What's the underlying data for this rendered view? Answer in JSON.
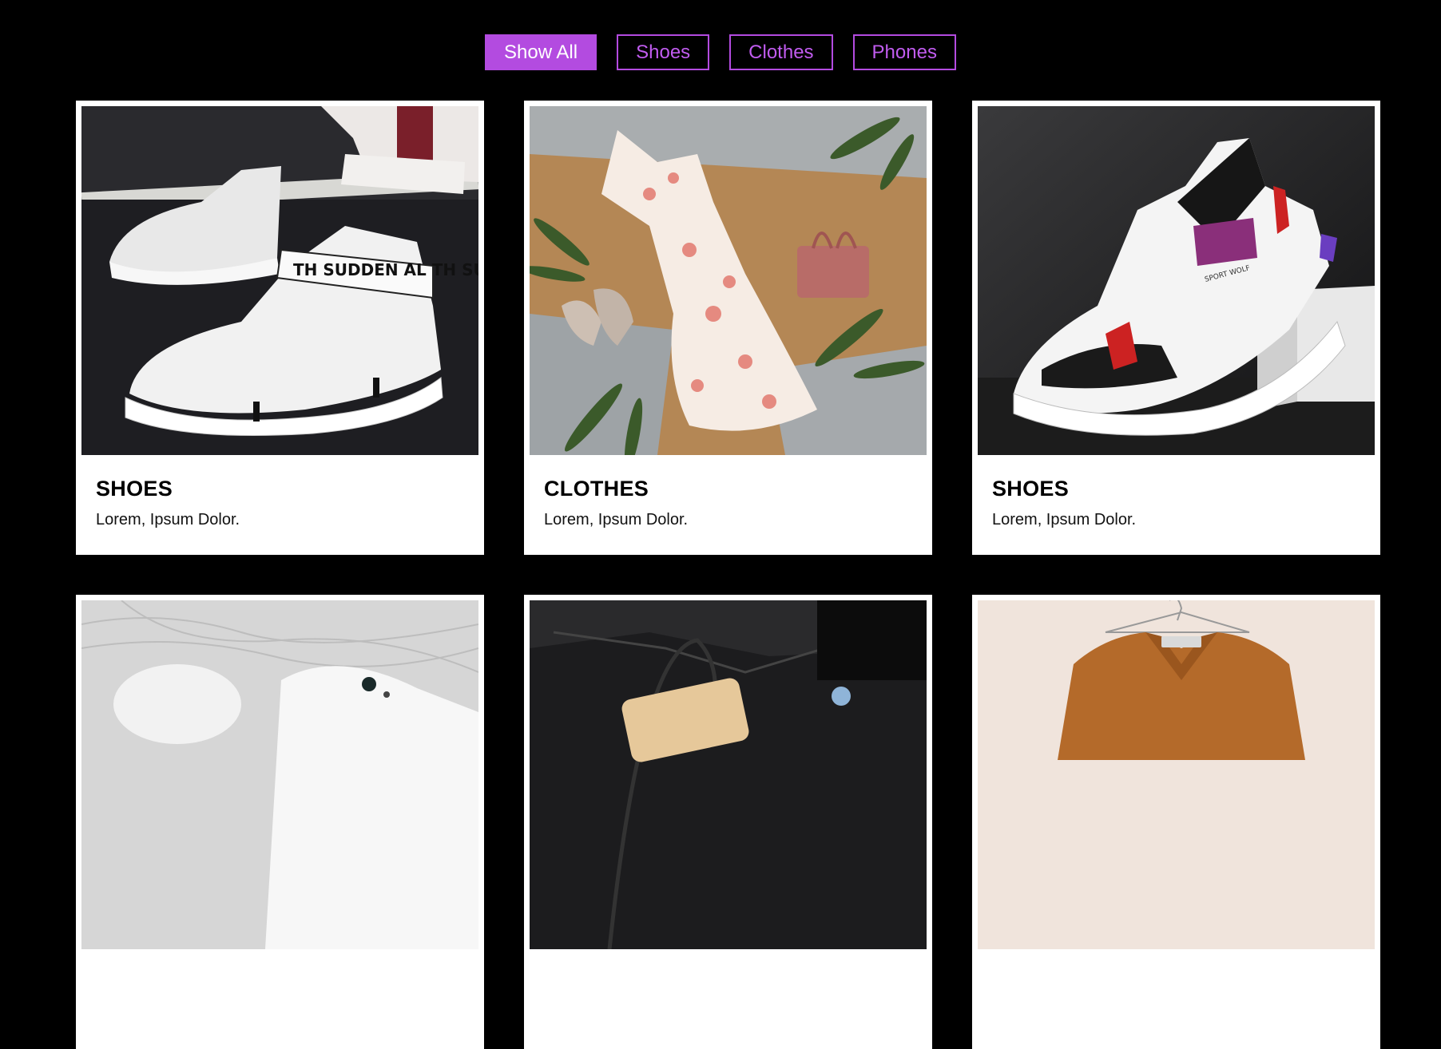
{
  "filters": [
    {
      "label": "Show All",
      "active": true
    },
    {
      "label": "Shoes",
      "active": false
    },
    {
      "label": "Clothes",
      "active": false
    },
    {
      "label": "Phones",
      "active": false
    }
  ],
  "cards": [
    {
      "title": "SHOES",
      "text": "Lorem, Ipsum Dolor.",
      "image": "white-high-top-sneaker-photo"
    },
    {
      "title": "CLOTHES",
      "text": "Lorem, Ipsum Dolor.",
      "image": "floral-dress-flatlay-photo"
    },
    {
      "title": "SHOES",
      "text": "Lorem, Ipsum Dolor.",
      "image": "sport-sneaker-photo"
    },
    {
      "title": "",
      "text": "",
      "image": "white-phone-earbuds-photo"
    },
    {
      "title": "",
      "text": "",
      "image": "black-leather-bag-photo"
    },
    {
      "title": "",
      "text": "",
      "image": "brown-corduroy-shirt-photo"
    }
  ],
  "colors": {
    "background": "#000000",
    "accent": "#b34be0",
    "card": "#ffffff"
  }
}
